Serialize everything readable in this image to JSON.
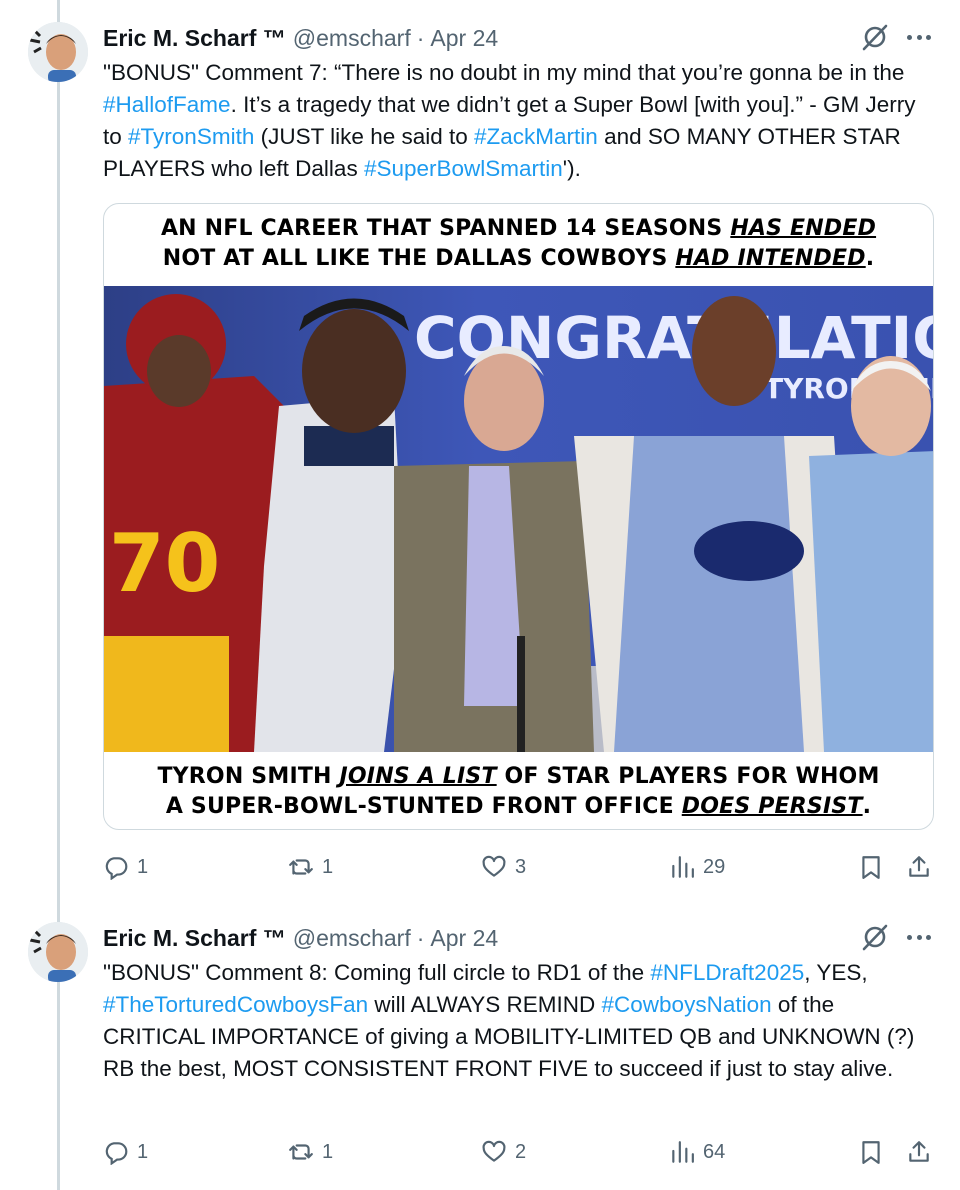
{
  "tweets": [
    {
      "author": {
        "name": "Eric M. Scharf ™",
        "handle": "@emscharf",
        "separator": "·",
        "date": "Apr 24"
      },
      "text": [
        {
          "t": "\"BONUS\" Comment 7: “There is no doubt in my mind that you’re gonna be in the ",
          "tag": false
        },
        {
          "t": "#HallofFame",
          "tag": true
        },
        {
          "t": ". It’s a tragedy that we didn’t get a Super Bowl [with you].” - GM Jerry to ",
          "tag": false
        },
        {
          "t": "#TyronSmith",
          "tag": true
        },
        {
          "t": " (JUST like he said to ",
          "tag": false
        },
        {
          "t": "#ZackMartin",
          "tag": true
        },
        {
          "t": " and SO MANY OTHER STAR PLAYERS who left Dallas ",
          "tag": false
        },
        {
          "t": "#SuperBowlSmartin",
          "tag": true
        },
        {
          "t": "').",
          "tag": false
        }
      ],
      "media": {
        "caption_top": {
          "line1_a": "AN NFL CAREER THAT SPANNED 14 SEASONS ",
          "line1_u": "HAS ENDED",
          "line2_a": "NOT AT ALL LIKE THE DALLAS COWBOYS ",
          "line2_u": "HAD INTENDED",
          "line2_end": "."
        },
        "banner_text": "CONGRATULATIONS",
        "banner_sub": "TYRON SMITH",
        "jersey_number": "70",
        "caption_bottom": {
          "line1_a": "TYRON SMITH ",
          "line1_u": "JOINS A LIST",
          "line1_b": " OF STAR PLAYERS FOR WHOM",
          "line2_a": "A SUPER-BOWL-STUNTED FRONT OFFICE ",
          "line2_u": "DOES PERSIST",
          "line2_end": "."
        }
      },
      "stats": {
        "replies": "1",
        "retweets": "1",
        "likes": "3",
        "views": "29"
      }
    },
    {
      "author": {
        "name": "Eric M. Scharf ™",
        "handle": "@emscharf",
        "separator": "·",
        "date": "Apr 24"
      },
      "text": [
        {
          "t": "\"BONUS\" Comment 8: Coming full circle to RD1 of the ",
          "tag": false
        },
        {
          "t": "#NFLDraft2025",
          "tag": true
        },
        {
          "t": ", YES, ",
          "tag": false
        },
        {
          "t": "#TheTorturedCowboysFan",
          "tag": true
        },
        {
          "t": " will ALWAYS REMIND ",
          "tag": false
        },
        {
          "t": "#CowboysNation",
          "tag": true
        },
        {
          "t": " of the CRITICAL IMPORTANCE of giving a MOBILITY-LIMITED QB and UNKNOWN (?) RB the best, MOST CONSISTENT FRONT FIVE to succeed if just to stay alive.",
          "tag": false
        }
      ],
      "stats": {
        "replies": "1",
        "retweets": "1",
        "likes": "2",
        "views": "64"
      }
    }
  ],
  "colors": {
    "link": "#1d9bf0",
    "muted": "#536471",
    "text": "#0f1419",
    "thread_line": "#cfd9de"
  },
  "icons": [
    "avatar",
    "grok-icon",
    "more-icon",
    "reply-icon",
    "retweet-icon",
    "like-icon",
    "views-icon",
    "bookmark-icon",
    "share-icon"
  ]
}
